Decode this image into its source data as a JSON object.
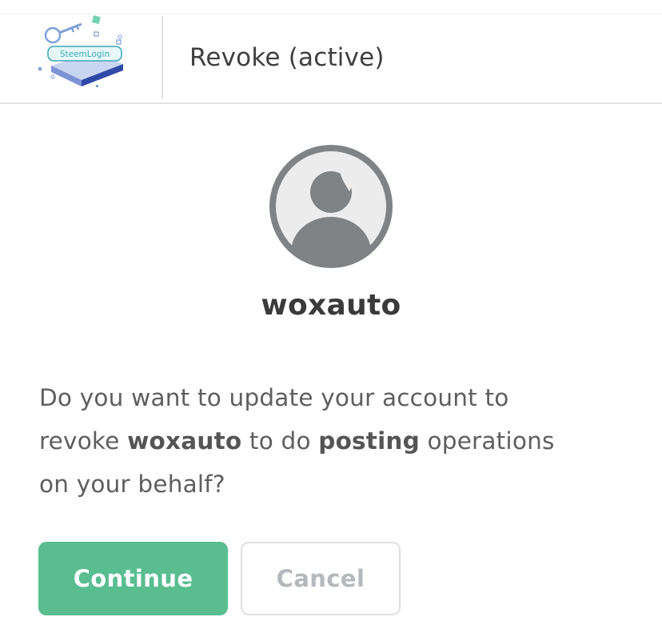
{
  "header": {
    "logo_text": "SteemLogin",
    "title": "Revoke (active)"
  },
  "account": {
    "username": "woxauto"
  },
  "message": {
    "line1": "Do you want to update your account to",
    "revoke_word": "revoke ",
    "account": "woxauto",
    "to_do": " to do ",
    "permission": "posting",
    "operations": " operations",
    "line3": "on your behalf?"
  },
  "actions": {
    "continue_label": "Continue",
    "cancel_label": "Cancel"
  },
  "colors": {
    "primary": "#59bd90",
    "avatar_gray": "#808386",
    "avatar_bg": "#ececec"
  }
}
